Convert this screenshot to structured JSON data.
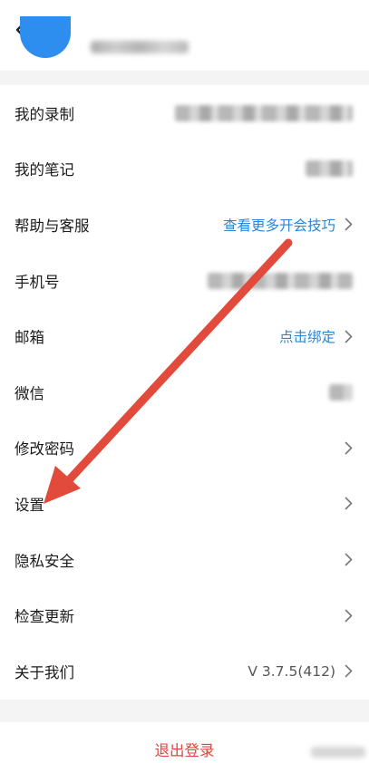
{
  "colors": {
    "accent": "#2b86d6",
    "danger": "#e0463d",
    "arrow": "#e24a3b",
    "avatar": "#2d8ef0"
  },
  "header": {
    "back_icon": "chevron-left-icon",
    "avatar_icon": "avatar"
  },
  "rows": [
    {
      "label": "我的录制"
    },
    {
      "label": "我的笔记"
    },
    {
      "label": "帮助与客服",
      "value": "查看更多开会技巧"
    },
    {
      "label": "手机号"
    },
    {
      "label": "邮箱",
      "value": "点击绑定"
    },
    {
      "label": "微信"
    },
    {
      "label": "修改密码"
    },
    {
      "label": "设置"
    },
    {
      "label": "隐私安全"
    },
    {
      "label": "检查更新"
    },
    {
      "label": "关于我们",
      "value": "V 3.7.5(412)"
    }
  ],
  "logout": {
    "label": "退出登录"
  },
  "annotation": {
    "type": "red-arrow",
    "points_to": "设置"
  }
}
